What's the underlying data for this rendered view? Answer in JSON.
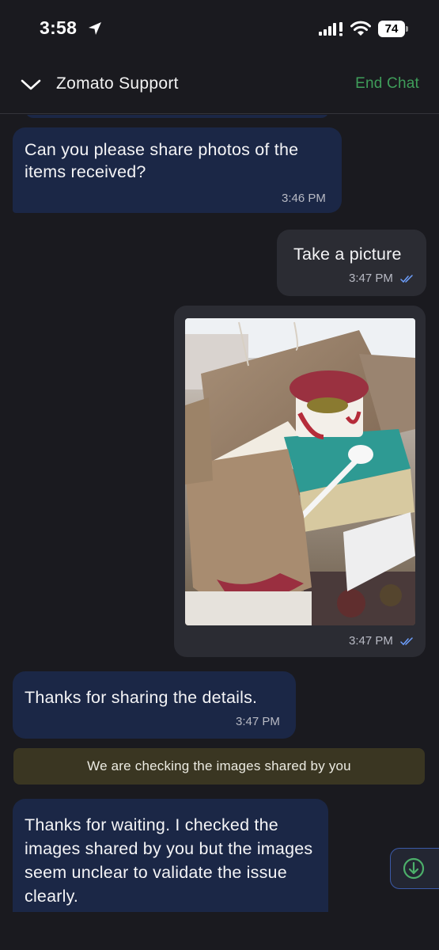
{
  "status_bar": {
    "time": "3:58",
    "battery": "74"
  },
  "header": {
    "title": "Zomato Support",
    "end_chat_label": "End Chat"
  },
  "messages": [
    {
      "side": "incoming",
      "text": "Can you please share photos of the items received?",
      "time": "3:46 PM"
    },
    {
      "side": "outgoing",
      "text": "Take a picture",
      "time": "3:47 PM",
      "read": true
    },
    {
      "side": "outgoing",
      "type": "image",
      "time": "3:47 PM",
      "read": true
    },
    {
      "side": "incoming",
      "text": "Thanks for sharing the details.",
      "time": "3:47 PM"
    },
    {
      "side": "system",
      "text": "We are checking the images shared by you"
    },
    {
      "side": "incoming",
      "text": "Thanks for waiting. I checked the images shared by you but the images seem unclear to validate the issue clearly."
    }
  ],
  "colors": {
    "background": "#1a1a1f",
    "incoming_bubble": "#1b2746",
    "outgoing_bubble": "#2b2c33",
    "system_banner": "#3a3622",
    "end_chat": "#3f9d5a",
    "read_tick": "#6ea0ff"
  },
  "icons": [
    "location-arrow-icon",
    "signal-icon",
    "wifi-icon",
    "battery-icon",
    "chevron-down-icon",
    "double-check-icon",
    "arrow-down-circle-icon"
  ]
}
